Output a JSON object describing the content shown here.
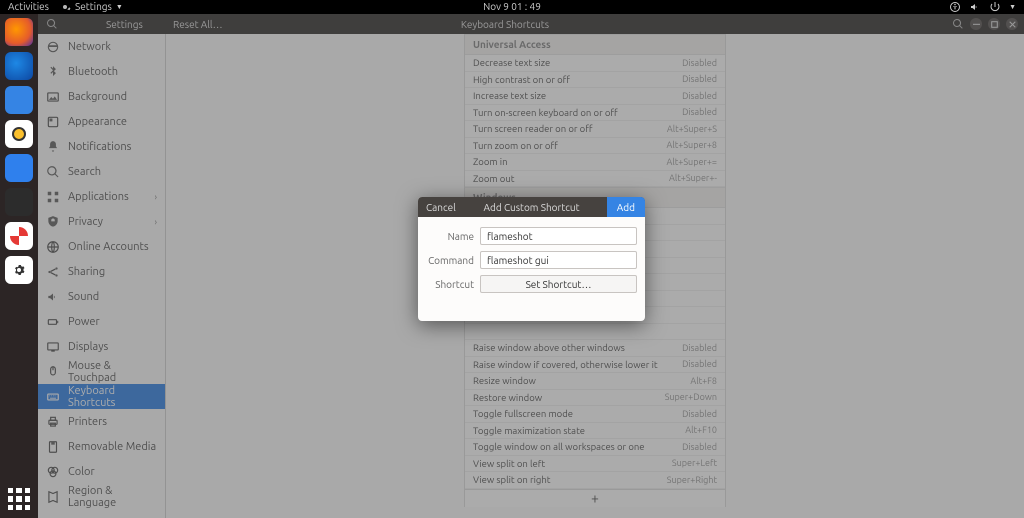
{
  "topbar": {
    "activities": "Activities",
    "app_label": "Settings",
    "clock": "Nov 9  01 : 49"
  },
  "window": {
    "left_title": "Settings",
    "reset_label": "Reset All…",
    "main_title": "Keyboard Shortcuts"
  },
  "sidebar": [
    {
      "icon": "network",
      "label": "Network"
    },
    {
      "icon": "bluetooth",
      "label": "Bluetooth"
    },
    {
      "icon": "background",
      "label": "Background"
    },
    {
      "icon": "appearance",
      "label": "Appearance"
    },
    {
      "icon": "bell",
      "label": "Notifications"
    },
    {
      "icon": "search",
      "label": "Search"
    },
    {
      "icon": "apps",
      "label": "Applications",
      "chev": true
    },
    {
      "icon": "privacy",
      "label": "Privacy",
      "chev": true
    },
    {
      "icon": "online",
      "label": "Online Accounts"
    },
    {
      "icon": "share",
      "label": "Sharing"
    },
    {
      "icon": "sound",
      "label": "Sound"
    },
    {
      "icon": "power",
      "label": "Power"
    },
    {
      "icon": "display",
      "label": "Displays"
    },
    {
      "icon": "mouse",
      "label": "Mouse & Touchpad"
    },
    {
      "icon": "keyboard",
      "label": "Keyboard Shortcuts",
      "active": true
    },
    {
      "icon": "printer",
      "label": "Printers"
    },
    {
      "icon": "removable",
      "label": "Removable Media"
    },
    {
      "icon": "color",
      "label": "Color"
    },
    {
      "icon": "region",
      "label": "Region & Language"
    }
  ],
  "shortcuts": {
    "section1_title": "Universal Access",
    "section1": [
      {
        "label": "Decrease text size",
        "key": "Disabled"
      },
      {
        "label": "High contrast on or off",
        "key": "Disabled"
      },
      {
        "label": "Increase text size",
        "key": "Disabled"
      },
      {
        "label": "Turn on-screen keyboard on or off",
        "key": "Disabled"
      },
      {
        "label": "Turn screen reader on or off",
        "key": "Alt+Super+S"
      },
      {
        "label": "Turn zoom on or off",
        "key": "Alt+Super+8"
      },
      {
        "label": "Zoom in",
        "key": "Alt+Super+="
      },
      {
        "label": "Zoom out",
        "key": "Alt+Super+-"
      }
    ],
    "section2_title": "Windows",
    "section2": [
      {
        "label": "Raise window above other windows",
        "key": "Disabled"
      },
      {
        "label": "Raise window if covered, otherwise lower it",
        "key": "Disabled"
      },
      {
        "label": "Resize window",
        "key": "Alt+F8"
      },
      {
        "label": "Restore window",
        "key": "Super+Down"
      },
      {
        "label": "Toggle fullscreen mode",
        "key": "Disabled"
      },
      {
        "label": "Toggle maximization state",
        "key": "Alt+F10"
      },
      {
        "label": "Toggle window on all workspaces or one",
        "key": "Disabled"
      },
      {
        "label": "View split on left",
        "key": "Super+Left"
      },
      {
        "label": "View split on right",
        "key": "Super+Right"
      }
    ],
    "add_symbol": "+"
  },
  "dialog": {
    "cancel": "Cancel",
    "title": "Add Custom Shortcut",
    "add": "Add",
    "name_label": "Name",
    "name_value": "flameshot",
    "command_label": "Command",
    "command_value": "flameshot gui",
    "shortcut_label": "Shortcut",
    "shortcut_button": "Set Shortcut…"
  }
}
